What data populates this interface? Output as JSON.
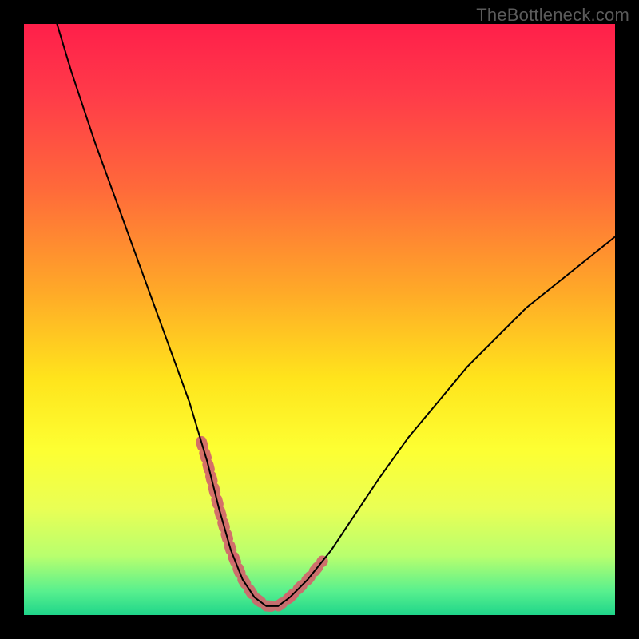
{
  "watermark": "TheBottleneck.com",
  "colors": {
    "bg": "#000000",
    "curve": "#000000",
    "segment": "#d1646b",
    "gradient_stops": [
      {
        "offset": 0.0,
        "color": "#ff1f4a"
      },
      {
        "offset": 0.12,
        "color": "#ff3b49"
      },
      {
        "offset": 0.28,
        "color": "#ff6a3a"
      },
      {
        "offset": 0.45,
        "color": "#ffa828"
      },
      {
        "offset": 0.6,
        "color": "#ffe41c"
      },
      {
        "offset": 0.72,
        "color": "#fdff32"
      },
      {
        "offset": 0.82,
        "color": "#e9ff55"
      },
      {
        "offset": 0.9,
        "color": "#b8ff6e"
      },
      {
        "offset": 0.96,
        "color": "#58f08e"
      },
      {
        "offset": 1.0,
        "color": "#1fd58a"
      }
    ]
  },
  "chart_data": {
    "type": "line",
    "title": "",
    "xlabel": "",
    "ylabel": "",
    "xlim": [
      0,
      100
    ],
    "ylim": [
      0,
      100
    ],
    "x": [
      5,
      8,
      12,
      16,
      20,
      24,
      28,
      31,
      33,
      35,
      37,
      39,
      41,
      43,
      45,
      48,
      52,
      56,
      60,
      65,
      70,
      75,
      80,
      85,
      90,
      95,
      100
    ],
    "values": [
      102,
      92,
      80,
      69,
      58,
      47,
      36,
      26,
      18,
      11,
      6,
      3,
      1.5,
      1.5,
      3,
      6,
      11,
      17,
      23,
      30,
      36,
      42,
      47,
      52,
      56,
      60,
      64
    ],
    "highlight_segments": [
      {
        "xstart": 30,
        "xend": 35.5,
        "side": "left"
      },
      {
        "xstart": 35.5,
        "xend": 45,
        "side": "bottom"
      },
      {
        "xstart": 45,
        "xend": 50.5,
        "side": "right"
      }
    ]
  }
}
